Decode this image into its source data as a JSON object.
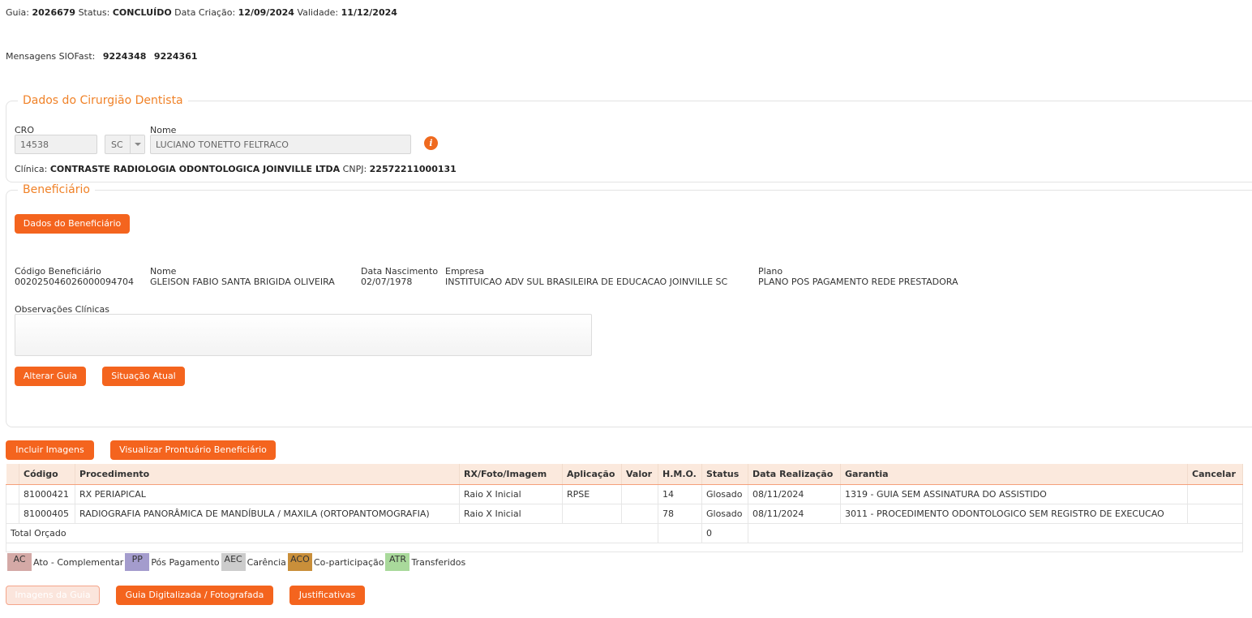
{
  "guide": {
    "guia_label": "Guia:",
    "guia_value": "2026679",
    "status_label": "Status:",
    "status_value": "CONCLUÍDO",
    "criacao_label": "Data Criação:",
    "criacao_value": "12/09/2024",
    "validade_label": "Validade:",
    "validade_value": "11/12/2024"
  },
  "messages": {
    "label": "Mensagens SIOFast:",
    "values": [
      "9224348",
      "9224361"
    ]
  },
  "dentist": {
    "legend": "Dados do Cirurgião Dentista",
    "cro_label": "CRO",
    "cro_value": "14538",
    "uf_value": "SC",
    "nome_label": "Nome",
    "nome_value": "LUCIANO TONETTO FELTRACO",
    "clinica_label": "Clínica:",
    "clinica_value": "CONTRASTE RADIOLOGIA ODONTOLOGICA JOINVILLE LTDA",
    "cnpj_label": "CNPJ:",
    "cnpj_value": "22572211000131",
    "info_icon": "i"
  },
  "beneficiary": {
    "legend": "Beneficiário",
    "dados_button": "Dados do Beneficiário",
    "codigo_label": "Código Beneficiário",
    "codigo_value": "00202504602600009470 4",
    "nome_label": "Nome",
    "nome_value": "GLEISON FABIO SANTA BRIGIDA OLIVEIRA",
    "nasc_label": "Data Nascimento",
    "nasc_value": "02/07/1978",
    "empresa_label": "Empresa",
    "empresa_value": "INSTITUICAO ADV SUL BRASILEIRA DE EDUCACAO JOINVILLE SC",
    "plano_label": "Plano",
    "plano_value": "PLANO POS PAGAMENTO REDE PRESTADORA",
    "obs_label": "Observações Clínicas",
    "obs_value": "",
    "alterar_button": "Alterar Guia",
    "situacao_button": "Situação Atual"
  },
  "actions": {
    "incluir_imagens": "Incluir Imagens",
    "visualizar_prontuario": "Visualizar Prontuário Beneficiário"
  },
  "table": {
    "headers": [
      "Código",
      "Procedimento",
      "RX/Foto/Imagem",
      "Aplicação",
      "Valor",
      "H.M.O.",
      "Status",
      "Data Realização",
      "Garantia",
      "Cancelar"
    ],
    "rows": [
      {
        "codigo": "81000421",
        "procedimento": "RX PERIAPICAL",
        "rx": "Raio X Inicial",
        "aplicacao": "RPSE",
        "valor": "",
        "hmo": "14",
        "status": "Glosado",
        "data": "08/11/2024",
        "garantia": "1319 - GUIA SEM ASSINATURA DO ASSISTIDO",
        "cancelar": ""
      },
      {
        "codigo": "81000405",
        "procedimento": "RADIOGRAFIA PANORÂMICA DE MANDÍBULA / MAXILA (ORTOPANTOMOGRAFIA)",
        "rx": "Raio X Inicial",
        "aplicacao": "",
        "valor": "",
        "hmo": "78",
        "status": "Glosado",
        "data": "08/11/2024",
        "garantia": "3011 - PROCEDIMENTO ODONTOLOGICO SEM REGISTRO DE EXECUCAO",
        "cancelar": ""
      }
    ],
    "total_label": "Total Orçado",
    "total_hmo": "0"
  },
  "legend": [
    {
      "code": "AC",
      "text": "Ato - Complementar",
      "color": "#d4a9a6"
    },
    {
      "code": "PP",
      "text": "Pós Pagamento",
      "color": "#a49ccd"
    },
    {
      "code": "AEC",
      "text": "Carência",
      "color": "#cccccc"
    },
    {
      "code": "ACO",
      "text": "Co-participação",
      "color": "#c98f3a"
    },
    {
      "code": "ATR",
      "text": "Transferidos",
      "color": "#a9d99b"
    }
  ],
  "footer": {
    "imagens_guia": "Imagens da Guia",
    "guia_digitalizada": "Guia Digitalizada / Fotografada",
    "justificativas": "Justificativas"
  }
}
